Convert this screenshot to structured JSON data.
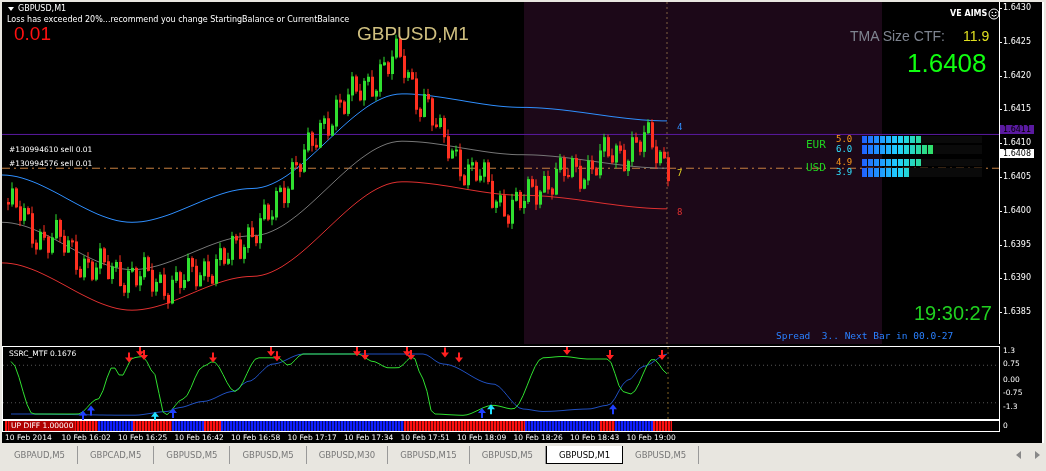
{
  "window": {
    "title": "GBPUSD,M1"
  },
  "alert": "Loss has exceeded 20%...recommend you change StartingBalance or CurrentBalance",
  "lot": "0.01",
  "symbol_label": "GBPUSD,M1",
  "brand": "VE AIMS",
  "tma": {
    "label": "TMA Size CTF:",
    "value": "11.9"
  },
  "price": "1.6408",
  "orders": [
    "#130994610 sell 0.01",
    "#130994576 sell 0.01"
  ],
  "band_labels": [
    {
      "text": "4",
      "kind": "upper"
    },
    {
      "text": "7",
      "kind": "middle"
    },
    {
      "text": "8",
      "kind": "lower"
    }
  ],
  "strength": [
    {
      "currency": "EUR",
      "rows": [
        {
          "value": "5.0",
          "level": 0.5,
          "kind": "first"
        },
        {
          "value": "6.0",
          "level": 0.6,
          "kind": "second"
        }
      ]
    },
    {
      "currency": "USD",
      "rows": [
        {
          "value": "4.9",
          "level": 0.49,
          "kind": "first"
        },
        {
          "value": "3.9",
          "level": 0.39,
          "kind": "second"
        }
      ]
    }
  ],
  "clock": "19:30:27",
  "status": "Spread  3.. Next Bar in 00.0-27",
  "price_axis": [
    "1.6430",
    "1.6425",
    "1.6420",
    "1.6415",
    "1.6410",
    "1.6405",
    "1.6400",
    "1.6395",
    "1.6390",
    "1.6385"
  ],
  "price_markers": [
    {
      "value": "1.6411",
      "kind": "ask"
    },
    {
      "value": "1.6408",
      "kind": "bid"
    }
  ],
  "indicator": {
    "title": "SSRC_MTF 0.1676",
    "axis": [
      "1.3",
      "0.75",
      "0.00",
      "-0.75",
      "-1.3"
    ]
  },
  "strip": {
    "title": "UP DIFF 1.00000",
    "axis": "0"
  },
  "time_axis": [
    "10 Feb 2014",
    "10 Feb 16:02",
    "10 Feb 16:25",
    "10 Feb 16:42",
    "10 Feb 16:58",
    "10 Feb 17:17",
    "10 Feb 17:34",
    "10 Feb 17:51",
    "10 Feb 18:09",
    "10 Feb 18:26",
    "10 Feb 18:43",
    "10 Feb 19:00"
  ],
  "tabs": [
    {
      "label": "GBPAUD,M5",
      "selected": false
    },
    {
      "label": "GBPCAD,M5",
      "selected": false
    },
    {
      "label": "GBPUSD,M5",
      "selected": false
    },
    {
      "label": "GBPUSD,M5",
      "selected": false
    },
    {
      "label": "GBPUSD,M30",
      "selected": false
    },
    {
      "label": "GBPUSD,M15",
      "selected": false
    },
    {
      "label": "GBPUSD,M5",
      "selected": false
    },
    {
      "label": "GBPUSD,M1",
      "selected": true
    },
    {
      "label": "GBPUSD,M5",
      "selected": false
    }
  ]
}
